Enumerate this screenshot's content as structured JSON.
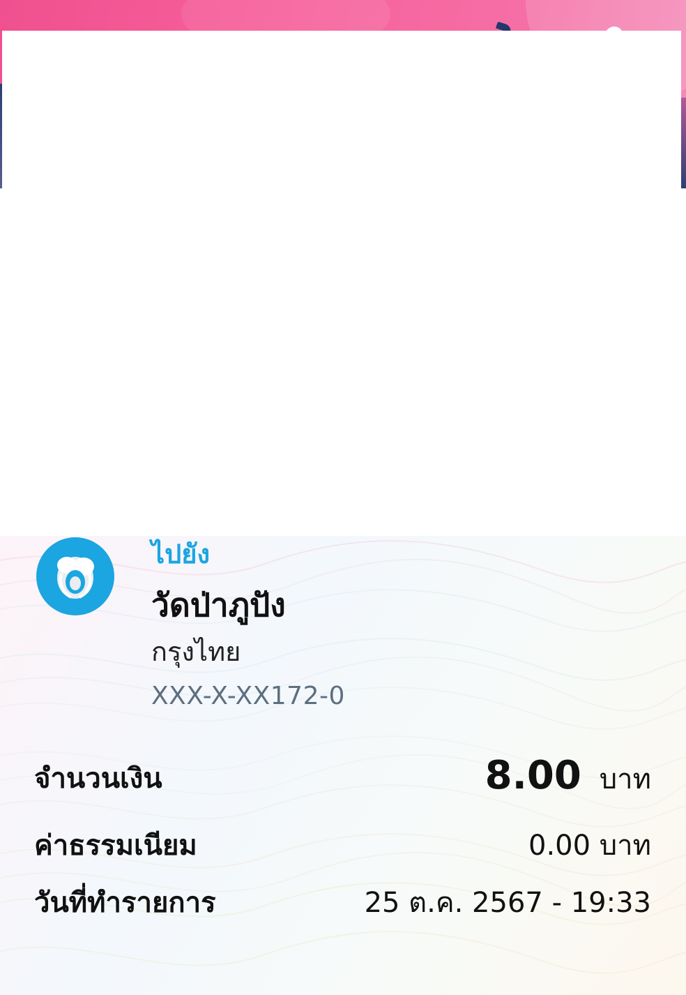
{
  "colors": {
    "banner_pink": "#f7619c",
    "accent_blue": "#1ba5e1",
    "account_gray": "#5c6f80",
    "text_dark": "#111111"
  },
  "recipient": {
    "to_label": "ไปยัง",
    "name": "วัดป่าภูปัง",
    "bank": "กรุงไทย",
    "account": "XXX-X-XX172-0",
    "bank_logo_icon": "krungthai-bank-logo-icon"
  },
  "details": {
    "amount_label": "จำนวนเงิน",
    "amount_value": "8.00",
    "amount_unit": "บาท",
    "fee_label": "ค่าธรรมเนียม",
    "fee_value": "0.00 บาท",
    "date_label": "วันที่ทำรายการ",
    "date_value": "25 ต.ค. 2567 - 19:33"
  }
}
